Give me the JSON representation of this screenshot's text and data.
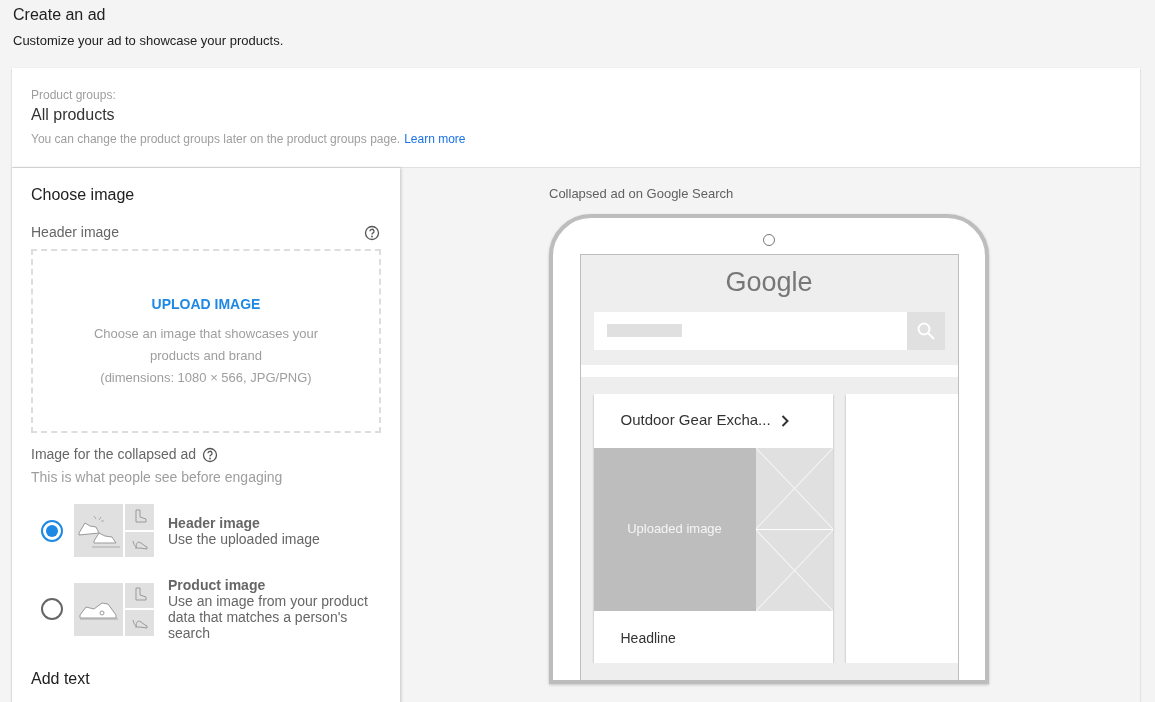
{
  "page": {
    "title": "Create an ad",
    "subtitle": "Customize your ad to showcase your products."
  },
  "product_groups": {
    "label": "Product groups:",
    "value": "All products",
    "note": "You can change the product groups later on the product groups page.",
    "link": "Learn more"
  },
  "choose_image": {
    "heading": "Choose image",
    "header_label": "Header image",
    "upload": {
      "button": "UPLOAD IMAGE",
      "lines": [
        "Choose an image that showcases your",
        "products and brand",
        "(dimensions: 1080 × 566, JPG/PNG)"
      ]
    },
    "collapsed_label": "Image for the collapsed ad",
    "collapsed_hint": "This is what people see before engaging",
    "options": [
      {
        "title": "Header image",
        "description": "Use the uploaded image",
        "selected": true,
        "kind": "pair"
      },
      {
        "title": "Product image",
        "description": "Use an image from your product data that matches a person's search",
        "selected": false,
        "kind": "single"
      }
    ]
  },
  "add_text": {
    "heading": "Add text"
  },
  "preview": {
    "caption": "Collapsed ad on Google Search",
    "logo": "Google",
    "ad": {
      "business": "Outdoor Gear Excha...",
      "image_label": "Uploaded image",
      "headline": "Headline"
    }
  }
}
